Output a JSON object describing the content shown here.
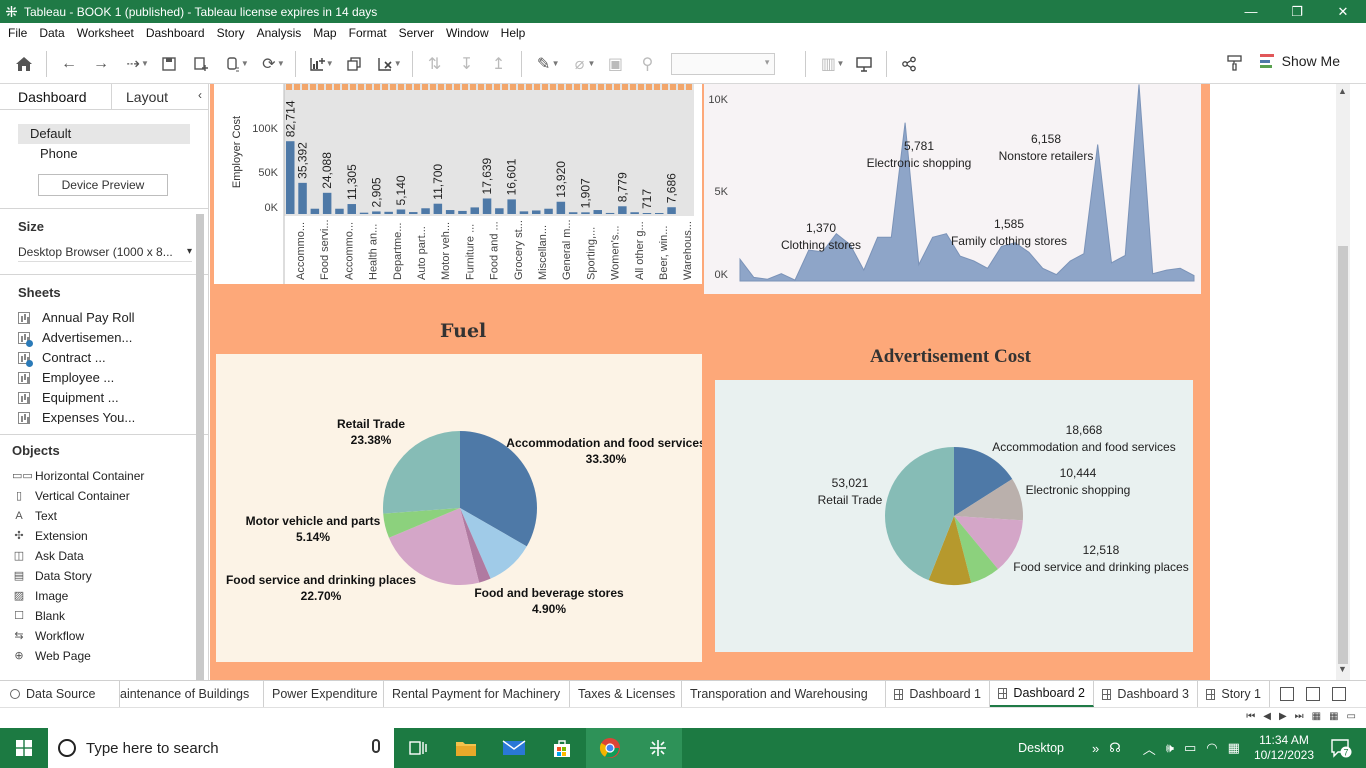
{
  "window": {
    "title": "Tableau - BOOK 1 (published) - Tableau license expires in 14 days",
    "minimize": "—",
    "restore": "❐",
    "close": "✕"
  },
  "menu": [
    "File",
    "Data",
    "Worksheet",
    "Dashboard",
    "Story",
    "Analysis",
    "Map",
    "Format",
    "Server",
    "Window",
    "Help"
  ],
  "toolbar": {
    "show_me": "Show Me"
  },
  "left_panel": {
    "tabs": [
      "Dashboard",
      "Layout"
    ],
    "collapse": "‹",
    "device_options": [
      "Default",
      "Phone"
    ],
    "device_preview": "Device Preview",
    "size_heading": "Size",
    "size_value": "Desktop Browser (1000 x 8...",
    "sheets_heading": "Sheets",
    "sheets": [
      {
        "label": "Annual Pay Roll",
        "used": false
      },
      {
        "label": "Advertisemen...",
        "used": true
      },
      {
        "label": "Contract ...",
        "used": true
      },
      {
        "label": "Employee ...",
        "used": false
      },
      {
        "label": "Equipment ...",
        "used": false
      },
      {
        "label": "Expenses You...",
        "used": false
      }
    ],
    "objects_heading": "Objects",
    "objects": [
      {
        "label": "Horizontal Container",
        "icon": "horizontal-container-icon",
        "glyph": "▭▭"
      },
      {
        "label": "Vertical Container",
        "icon": "vertical-container-icon",
        "glyph": "▯"
      },
      {
        "label": "Text",
        "icon": "text-icon",
        "glyph": "A"
      },
      {
        "label": "Extension",
        "icon": "puzzle-icon",
        "glyph": "✣"
      },
      {
        "label": "Ask Data",
        "icon": "ask-data-icon",
        "glyph": "◫"
      },
      {
        "label": "Data Story",
        "icon": "data-story-icon",
        "glyph": "▤"
      },
      {
        "label": "Image",
        "icon": "image-icon",
        "glyph": "▨"
      },
      {
        "label": "Blank",
        "icon": "blank-icon",
        "glyph": "☐"
      },
      {
        "label": "Workflow",
        "icon": "workflow-icon",
        "glyph": "⇆"
      },
      {
        "label": "Web Page",
        "icon": "globe-icon",
        "glyph": "⊕"
      }
    ]
  },
  "charts": {
    "employer": {
      "ylabel": "Employer Cost",
      "yticks": [
        "100K",
        "50K",
        "0K"
      ],
      "categories": [
        "Accommo...",
        "Food servi...",
        "Accommo...",
        "Health an...",
        "Departme...",
        "Auto part...",
        "Motor veh...",
        "Furniture ...",
        "Food and ...",
        "Grocery st...",
        "Miscellan...",
        "General m...",
        "Sporting,...",
        "Women's...",
        "All other g...",
        "Beer, win...",
        "Warehous..."
      ],
      "labels": [
        "82,714",
        "35,392",
        "24,088",
        "11,305",
        "2,905",
        "5,140",
        "11,700",
        "17,639",
        "16,601",
        "13,920",
        "1,907",
        "8,779",
        "717",
        "7,686"
      ]
    },
    "area": {
      "yticks": [
        "10K",
        "5K",
        "0K"
      ],
      "annotations": [
        {
          "value": "5,781",
          "label": "Electronic shopping"
        },
        {
          "value": "6,158",
          "label": "Nonstore retailers"
        },
        {
          "value": "1,370",
          "label": "Clothing stores"
        },
        {
          "value": "1,585",
          "label": "Family clothing stores"
        }
      ]
    },
    "fuel": {
      "title": "Fuel",
      "slices": [
        {
          "label": "Accommodation and food services",
          "pct": "33.30%",
          "color": "#4e79a7"
        },
        {
          "label": "Food and beverage stores",
          "pct": "4.90%",
          "color": "#a0cbe8"
        },
        {
          "label": "Food service and drinking places",
          "pct": "22.70%",
          "color": "#d4a6c8"
        },
        {
          "label": "Motor vehicle and parts",
          "pct": "5.14%",
          "color": "#8cd17d"
        },
        {
          "label": "Retail Trade",
          "pct": "23.38%",
          "color": "#86bcb6"
        }
      ]
    },
    "adv": {
      "title": "Advertisement Cost",
      "slices": [
        {
          "value": "18,668",
          "label": "Accommodation and food services",
          "color": "#4e79a7"
        },
        {
          "value": "10,444",
          "label": "Electronic shopping",
          "color": "#bab0ac"
        },
        {
          "value": "12,518",
          "label": "Food service and drinking places",
          "color": "#d4a6c8"
        },
        {
          "value": "53,021",
          "label": "Retail Trade",
          "color": "#86bcb6"
        }
      ]
    }
  },
  "sheet_tabs": [
    "Data Source",
    "aintenance of Buildings",
    "Power Expenditure",
    "Rental Payment for Machinery",
    "Taxes & Licenses",
    "Transporation and Warehousing",
    "Dashboard 1",
    "Dashboard 2",
    "Dashboard 3",
    "Story 1"
  ],
  "taskbar": {
    "search_placeholder": "Type here to search",
    "desktop": "Desktop",
    "time": "11:34 AM",
    "date": "10/12/2023",
    "notifications": "7"
  }
}
